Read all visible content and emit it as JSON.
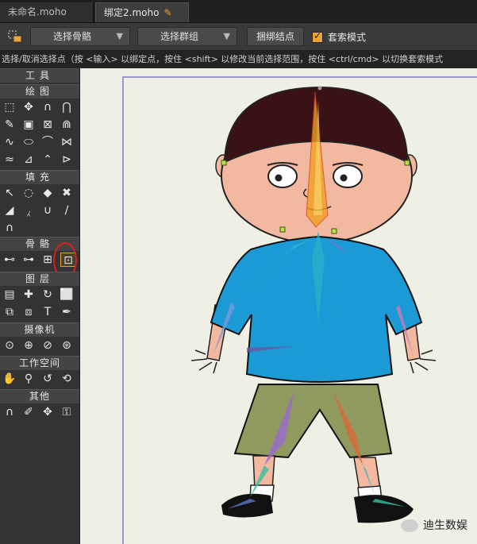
{
  "tabs": [
    {
      "label": "未命名.moho"
    },
    {
      "label": "绑定2.moho"
    }
  ],
  "options_bar": {
    "select_bone": "选择骨骼",
    "select_group": "选择群组",
    "bind_points": "捆绑结点",
    "lasso_mode": "套索模式",
    "lasso_checked": true
  },
  "status_text": "选择/取消选择点（按 <输入> 以绑定点，按住 <shift> 以修改当前选择范围，按住 <ctrl/cmd> 以切换套索模式",
  "toolbox": {
    "title": "工具",
    "sections": {
      "draw": "绘图",
      "fill": "填充",
      "bone": "骨骼",
      "layer": "图层",
      "camera": "摄像机",
      "workspace": "工作空间",
      "other": "其他"
    }
  },
  "watermark": "迪生数娱",
  "colors": {
    "accent": "#e8a33a",
    "shirt": "#1b9ad6",
    "shorts": "#8f9a5e",
    "skin": "#f3b9a0",
    "hair": "#3a1215"
  }
}
